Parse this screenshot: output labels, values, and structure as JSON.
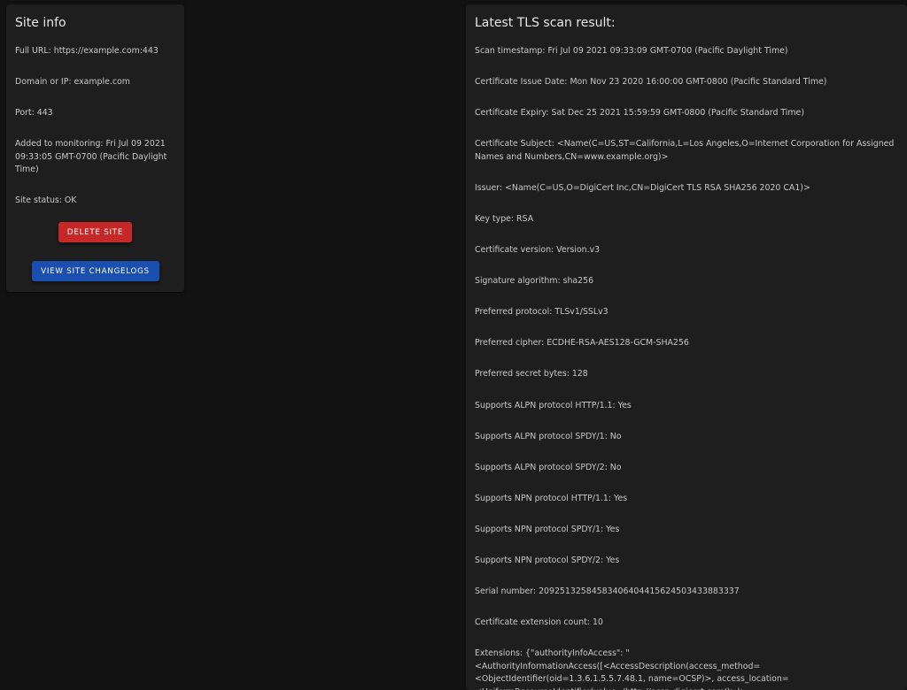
{
  "site_info": {
    "title": "Site info",
    "full_url": "Full URL: https://example.com:443",
    "domain": "Domain or IP: example.com",
    "port": "Port: 443",
    "added": "Added to monitoring: Fri Jul 09 2021 09:33:05 GMT-0700 (Pacific Daylight Time)",
    "status": "Site status: OK",
    "delete_label": "DELETE SITE",
    "changelog_label": "VIEW SITE CHANGELOGS",
    "colors": {
      "delete": "#c62828",
      "changelog": "#1a4fb0"
    }
  },
  "tls": {
    "title": "Latest TLS scan result:",
    "lines": [
      "Scan timestamp: Fri Jul 09 2021 09:33:09 GMT-0700 (Pacific Daylight Time)",
      "Certificate Issue Date: Mon Nov 23 2020 16:00:00 GMT-0800 (Pacific Standard Time)",
      "Certificate Expiry: Sat Dec 25 2021 15:59:59 GMT-0800 (Pacific Standard Time)",
      "Certificate Subject: <Name(C=US,ST=California,L=Los Angeles,O=Internet Corporation for Assigned Names and Numbers,CN=www.example.org)>",
      "Issuer: <Name(C=US,O=DigiCert Inc,CN=DigiCert TLS RSA SHA256 2020 CA1)>",
      "Key type: RSA",
      "Certificate version: Version.v3",
      "Signature algorithm: sha256",
      "Preferred protocol: TLSv1/SSLv3",
      "Preferred cipher: ECDHE-RSA-AES128-GCM-SHA256",
      "Preferred secret bytes: 128",
      "Supports ALPN protocol HTTP/1.1: Yes",
      "Supports ALPN protocol SPDY/1: No",
      "Supports ALPN protocol SPDY/2: No",
      "Supports NPN protocol HTTP/1.1: Yes",
      "Supports NPN protocol SPDY/1: Yes",
      "Supports NPN protocol SPDY/2: Yes",
      "Serial number: 20925132584583406404415624503433883337",
      "Certificate extension count: 10",
      "Extensions: {\"authorityInfoAccess\": \"<AuthorityInformationAccess([<AccessDescription(access_method=<ObjectIdentifier(oid=1.3.6.1.5.5.7.48.1, name=OCSP)>, access_location=<UniformResourceIdentifier(value='http://ocsp.digicert.com')>)>, <AccessDescription(access_method="
    ]
  }
}
